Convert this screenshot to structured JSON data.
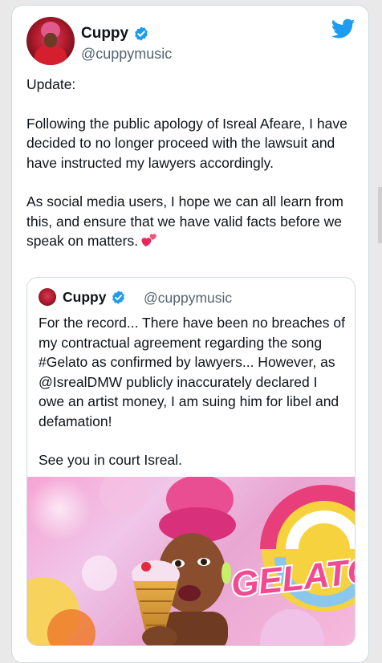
{
  "author": {
    "name": "Cuppy",
    "handle": "@cuppymusic"
  },
  "tweet": {
    "update_label": "Update:",
    "paragraph1": "Following the public apology of Isreal Afeare, I have decided to no longer proceed with the lawsuit and have instructed my lawyers accordingly.",
    "paragraph2": "As social media users, I hope we can all learn from this, and ensure that we have valid facts before we speak on matters."
  },
  "quoted_tweet": {
    "name": "Cuppy",
    "handle": "@cuppymusic",
    "paragraph1": "For the record... There have been no breaches of my contractual agreement regarding the song #Gelato as confirmed by lawyers... However, as @IsrealDMW publicly inaccurately declared I owe an artist money, I am suing him for libel and defamation!",
    "paragraph2": "See you in court Isreal.",
    "media_title": "GELATO"
  },
  "icons": {
    "verified": "verified-badge-icon",
    "twitter": "twitter-bird-icon",
    "heart": "two-hearts-emoji"
  },
  "colors": {
    "twitter_blue": "#1d9bf0",
    "text": "#0f1419",
    "secondary_text": "#536471",
    "border": "#cfd9de",
    "heart": "#e8275b"
  }
}
